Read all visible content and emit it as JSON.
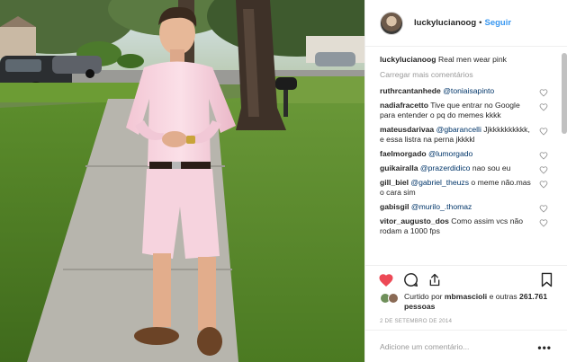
{
  "post": {
    "username": "luckylucianoog",
    "separator": "•",
    "follow_label": "Seguir",
    "caption": "Real men wear pink",
    "load_more": "Carregar mais comentários",
    "comments": [
      {
        "user": "ruthrcantanhede",
        "mention": "@toniaisapinto",
        "text": ""
      },
      {
        "user": "nadiafracetto",
        "mention": "",
        "text": "Tive que entrar no Google para entender o pq do memes kkkk"
      },
      {
        "user": "mateusdarivaa",
        "mention": "@gbarancelli",
        "text": "Jjkkkkkkkkkk, e essa listra na perna jkkkkl"
      },
      {
        "user": "faelmorgado",
        "mention": "@lumorgado",
        "text": ""
      },
      {
        "user": "guikairalla",
        "mention": "@prazerdidico",
        "text": "nao sou eu"
      },
      {
        "user": "gill_biel",
        "mention": "@gabriel_theuzs",
        "text": "o meme não.mas o cara sim"
      },
      {
        "user": "gabisgil",
        "mention": "@murilo_.thomaz",
        "text": ""
      },
      {
        "user": "vitor_augusto_dos",
        "mention": "",
        "text": "Como assim vcs não rodam a 1000 fps"
      }
    ],
    "liked_by_prefix": "Curtido por",
    "liked_by_user": "mbmascioli",
    "liked_by_middle": "e outras",
    "likes_count": "261.761 pessoas",
    "date": "2 DE SETEMBRO DE 2014",
    "add_comment_placeholder": "Adicione um comentário...",
    "options_label": "•••"
  },
  "colors": {
    "like_red": "#ed4956",
    "link_blue": "#3897f0",
    "mention_blue": "#003569",
    "muted_gray": "#999999"
  },
  "icons": [
    "heart-icon",
    "comment-icon",
    "share-icon",
    "bookmark-icon",
    "comment-like-icon"
  ]
}
